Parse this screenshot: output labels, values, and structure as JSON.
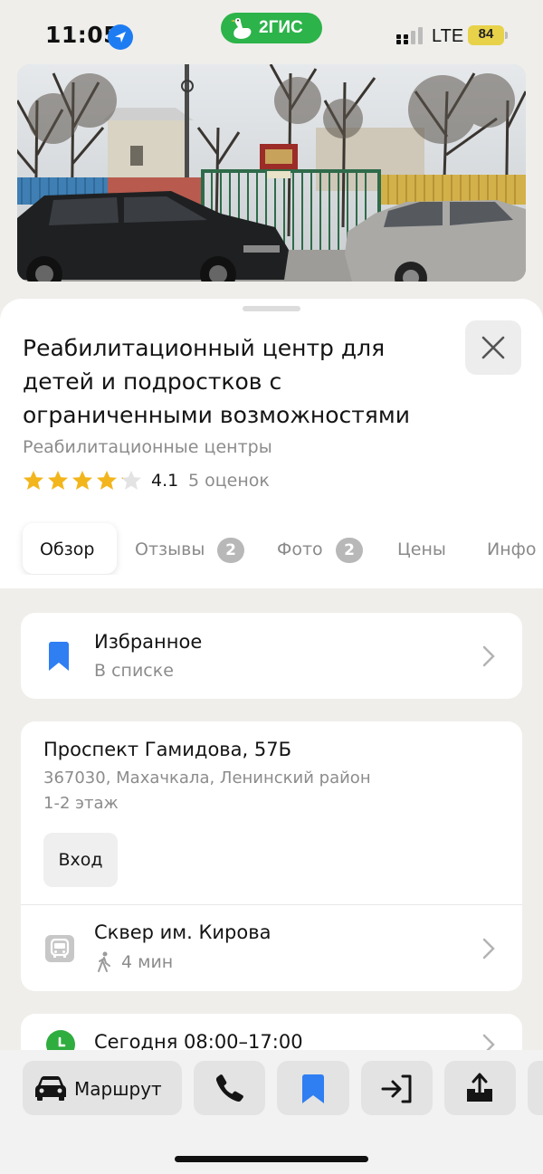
{
  "status_bar": {
    "time": "11:05",
    "app_badge": "2ГИС",
    "network": "LTE",
    "battery": "84"
  },
  "place": {
    "title": "Реабилитационный центр для детей и подростков с ограниченными возможностями",
    "category": "Реабилитационные центры",
    "rating": "4.1",
    "rating_stars": 4.1,
    "rating_count": "5 оценок"
  },
  "tabs": [
    {
      "label": "Обзор",
      "active": true
    },
    {
      "label": "Отзывы",
      "badge": "2"
    },
    {
      "label": "Фото",
      "badge": "2"
    },
    {
      "label": "Цены"
    },
    {
      "label": "Инфо"
    }
  ],
  "favorites": {
    "title": "Избранное",
    "subtitle": "В списке",
    "icon": "bookmark-icon"
  },
  "address": {
    "street": "Проспект Гамидова, 57Б",
    "details": "367030, Махачкала, Ленинский район",
    "floor": "1-2 этаж",
    "entrance_label": "Вход"
  },
  "transit": {
    "stop_name": "Сквер им. Кирова",
    "walk_time": "4 мин",
    "icon": "bus-icon"
  },
  "hours": {
    "text": "Сегодня 08:00–17:00",
    "icon": "clock-icon"
  },
  "actions": {
    "route_label": "Маршрут",
    "icons": [
      "car-icon",
      "phone-icon",
      "bookmark-icon",
      "enter-icon",
      "share-icon"
    ]
  },
  "colors": {
    "brand_green": "#2cb34a",
    "accent_blue": "#2f7ef2",
    "star_gold": "#f2b51b",
    "hours_green": "#2fad3f"
  }
}
